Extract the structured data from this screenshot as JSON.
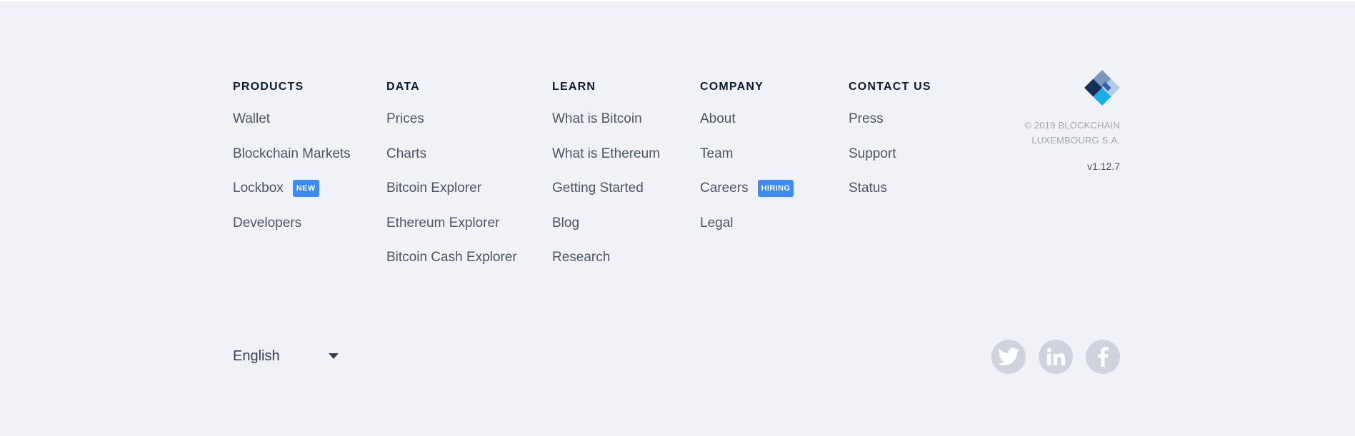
{
  "columns": [
    {
      "heading": "PRODUCTS",
      "links": [
        {
          "label": "Wallet",
          "badge": ""
        },
        {
          "label": "Blockchain Markets",
          "badge": ""
        },
        {
          "label": "Lockbox",
          "badge": "NEW"
        },
        {
          "label": "Developers",
          "badge": ""
        }
      ]
    },
    {
      "heading": "DATA",
      "links": [
        {
          "label": "Prices",
          "badge": ""
        },
        {
          "label": "Charts",
          "badge": ""
        },
        {
          "label": "Bitcoin Explorer",
          "badge": ""
        },
        {
          "label": "Ethereum Explorer",
          "badge": ""
        },
        {
          "label": "Bitcoin Cash Explorer",
          "badge": ""
        }
      ]
    },
    {
      "heading": "LEARN",
      "links": [
        {
          "label": "What is Bitcoin",
          "badge": ""
        },
        {
          "label": "What is Ethereum",
          "badge": ""
        },
        {
          "label": "Getting Started",
          "badge": ""
        },
        {
          "label": "Blog",
          "badge": ""
        },
        {
          "label": "Research",
          "badge": ""
        }
      ]
    },
    {
      "heading": "COMPANY",
      "links": [
        {
          "label": "About",
          "badge": ""
        },
        {
          "label": "Team",
          "badge": ""
        },
        {
          "label": "Careers",
          "badge": "HIRING"
        },
        {
          "label": "Legal",
          "badge": ""
        }
      ]
    },
    {
      "heading": "CONTACT US",
      "links": [
        {
          "label": "Press",
          "badge": ""
        },
        {
          "label": "Support",
          "badge": ""
        },
        {
          "label": "Status",
          "badge": ""
        }
      ]
    }
  ],
  "brand": {
    "logo_icon": "blockchain-logo-icon",
    "copyright_line1": "© 2019 BLOCKCHAIN",
    "copyright_line2": "LUXEMBOURG S.A.",
    "version": "v1.12.7"
  },
  "language": {
    "selected": "English",
    "icon": "chevron-down-icon"
  },
  "social": [
    {
      "name": "twitter",
      "icon": "twitter-icon"
    },
    {
      "name": "linkedin",
      "icon": "linkedin-icon"
    },
    {
      "name": "facebook",
      "icon": "facebook-icon"
    }
  ],
  "colors": {
    "background": "#f0f2f7",
    "heading": "#0c1b33",
    "link": "#4d5561",
    "badge": "#3d89f5",
    "social_circle": "#ced3de",
    "muted_text": "#a2a7b0"
  }
}
